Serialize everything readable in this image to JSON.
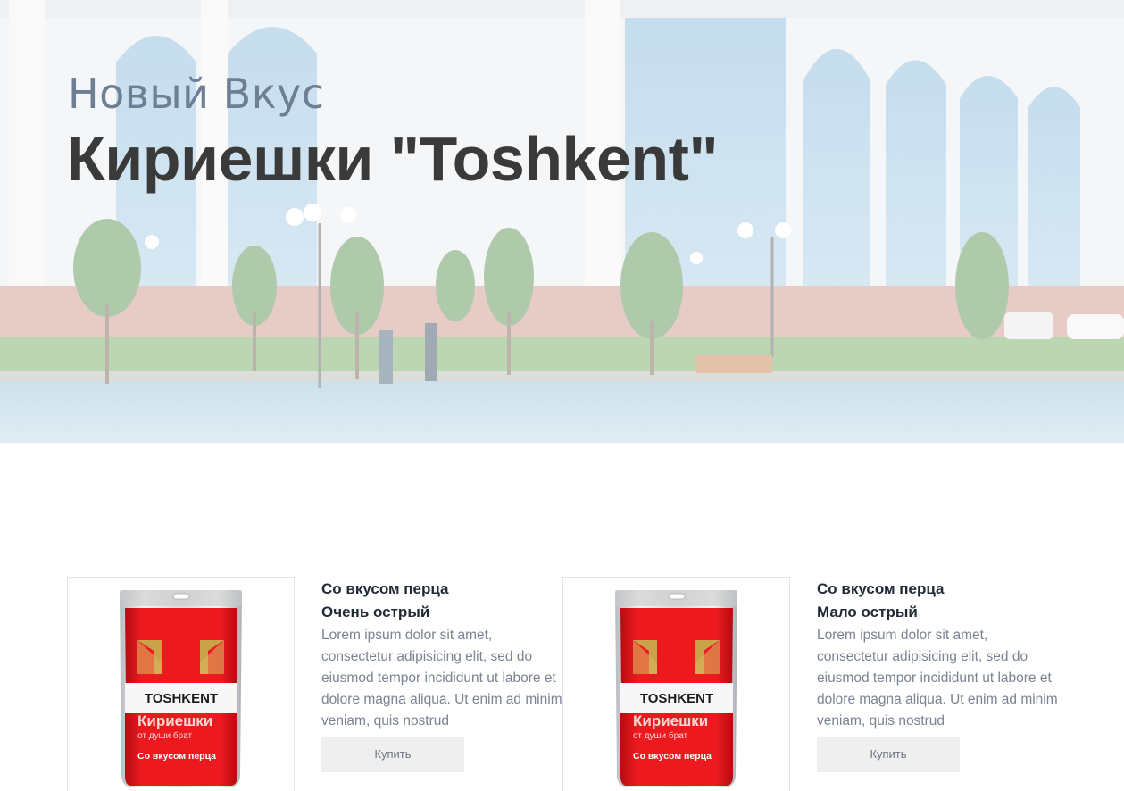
{
  "hero": {
    "subtitle": "Новый Вкус",
    "title": "Кириешки \"Toshkent\""
  },
  "products": [
    {
      "name": "Со вкусом перца",
      "level": "Очень острый",
      "description": "Lorem ipsum dolor sit amet, consectetur adipisicing elit, sed do eiusmod tempor incididunt ut labore et dolore magna aliqua. Ut enim ad minim veniam, quis nostrud",
      "button": "Купить",
      "package": {
        "brand": "TOSHKENT",
        "product": "Кириешки",
        "tagline": "от души брат",
        "flavor": "Со вкусом перца"
      }
    },
    {
      "name": "Со вкусом перца",
      "level": "Мало острый",
      "description": "Lorem ipsum dolor sit amet, consectetur adipisicing elit, sed do eiusmod tempor incididunt ut labore et dolore magna aliqua. Ut enim ad minim veniam, quis nostrud",
      "button": "Купить",
      "package": {
        "brand": "TOSHKENT",
        "product": "Кириешки",
        "tagline": "от души брат",
        "flavor": "Со вкусом перца"
      }
    }
  ],
  "colors": {
    "package_red": "#e8161b",
    "package_gold": "#c9a24a",
    "title_dark": "#3a3a3a",
    "subtitle_blue_gray": "#6e7f95",
    "button_bg": "#efefef"
  }
}
